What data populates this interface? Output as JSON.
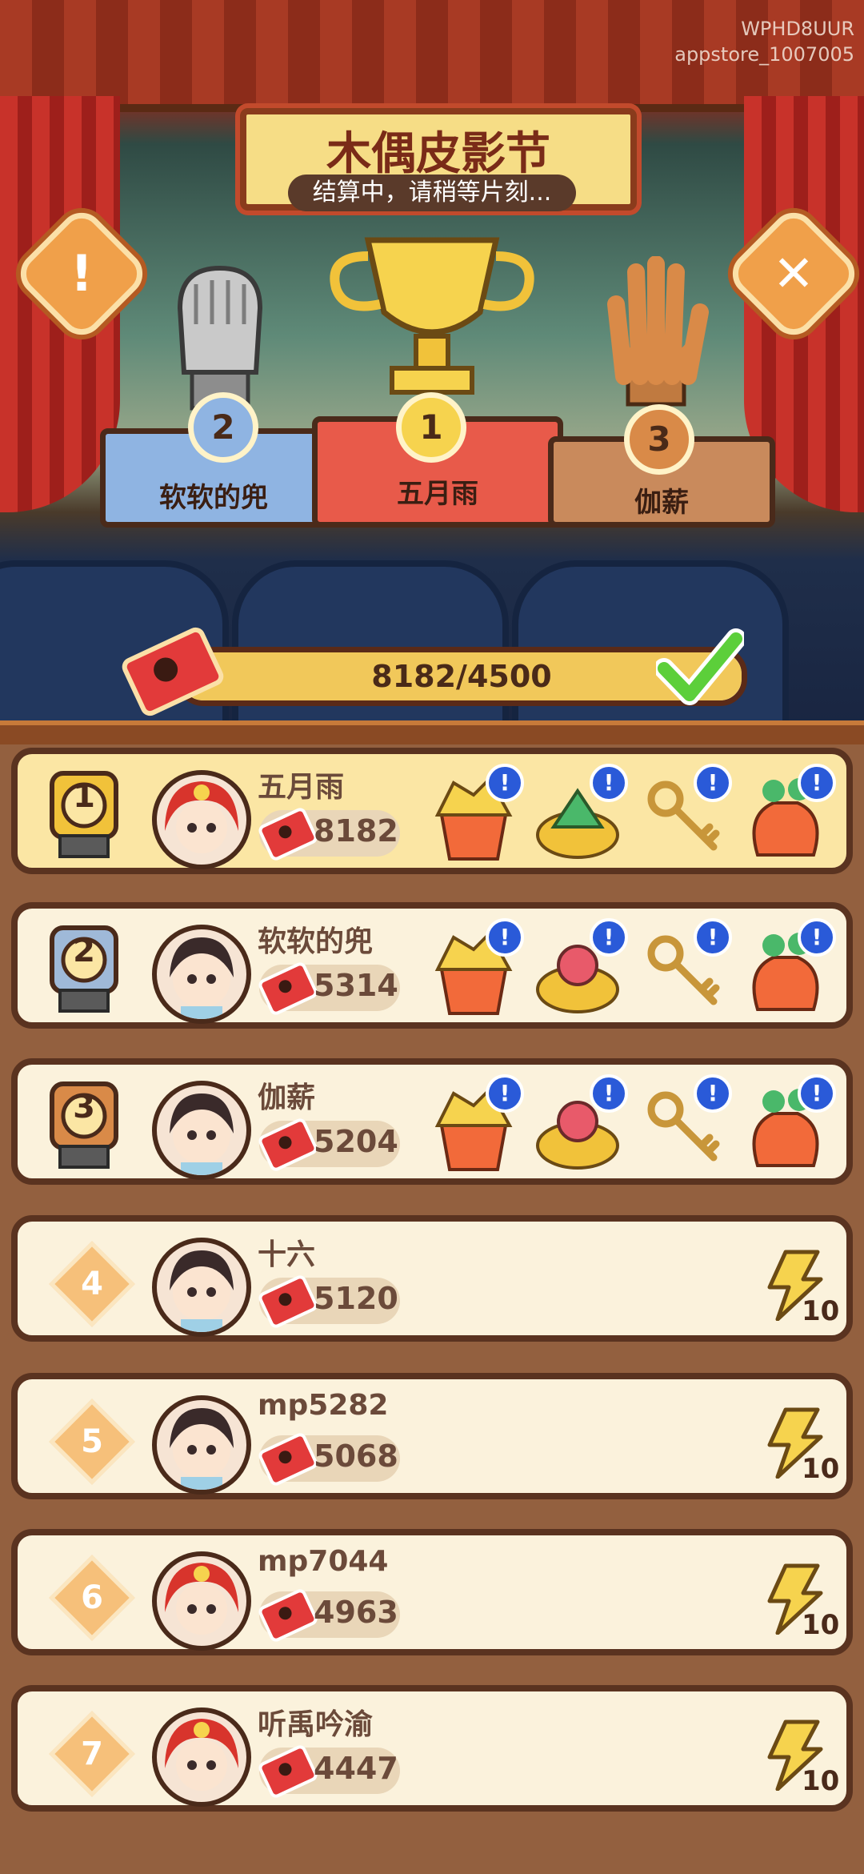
{
  "watermark": {
    "line1": "WPHD8UUR",
    "line2": "appstore_1007005"
  },
  "header": {
    "title": "木偶皮影节",
    "subtitle": "结算中，请稍等片刻..."
  },
  "buttons": {
    "info": "!",
    "close": "✕"
  },
  "podium": {
    "first": {
      "rank": "1",
      "name": "五月雨"
    },
    "second": {
      "rank": "2",
      "name": "软软的兜"
    },
    "third": {
      "rank": "3",
      "name": "伽薪"
    }
  },
  "progress": {
    "text": "8182/4500",
    "fraction": 1.0
  },
  "colors": {
    "accent": "#f1c85a",
    "ticket": "#e23a3a",
    "check": "#5ccf3a",
    "badge": "#2a5ad8"
  },
  "rankings": [
    {
      "rank": "1",
      "name": "五月雨",
      "score": "8182",
      "avatar": "opera-girl-avatar",
      "rewards": [
        "gold-bucket-icon",
        "jade-treasure-bowl-icon",
        "golden-key-icon",
        "gem-bag-icon"
      ]
    },
    {
      "rank": "2",
      "name": "软软的兜",
      "score": "5314",
      "avatar": "girl-avatar",
      "rewards": [
        "gold-bucket-icon",
        "treasure-bowl-icon",
        "golden-key-icon",
        "gem-bag-icon"
      ]
    },
    {
      "rank": "3",
      "name": "伽薪",
      "score": "5204",
      "avatar": "girl-avatar",
      "rewards": [
        "gold-bucket-icon",
        "treasure-bowl-icon",
        "golden-key-icon",
        "gem-bag-icon"
      ]
    },
    {
      "rank": "4",
      "name": "十六",
      "score": "5120",
      "avatar": "girl-avatar",
      "bolt": "10"
    },
    {
      "rank": "5",
      "name": "mp5282",
      "score": "5068",
      "avatar": "girl-avatar",
      "bolt": "10"
    },
    {
      "rank": "6",
      "name": "mp7044",
      "score": "4963",
      "avatar": "opera-girl-avatar",
      "bolt": "10"
    },
    {
      "rank": "7",
      "name": "听禹吟渝",
      "score": "4447",
      "avatar": "opera-girl-avatar",
      "bolt": "10"
    }
  ]
}
